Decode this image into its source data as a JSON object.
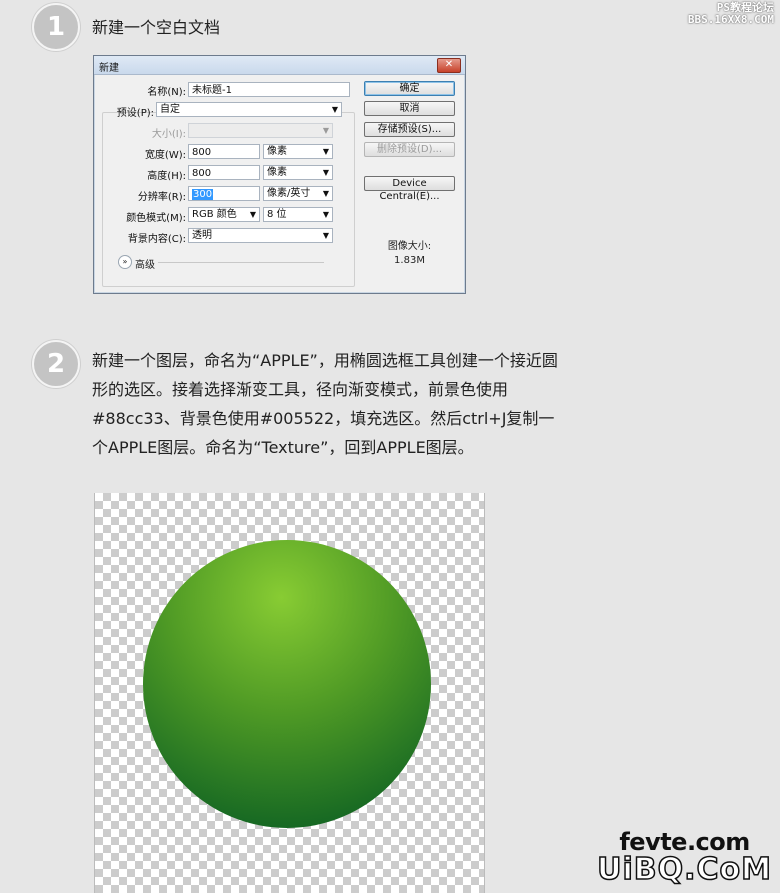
{
  "watermark_top": {
    "line1": "PS教程论坛",
    "line2": "BBS.16XX8.COM"
  },
  "steps": [
    {
      "number": "1",
      "title": "新建一个空白文档"
    },
    {
      "number": "2",
      "text": "新建一个图层，命名为“APPLE”，用椭圆选框工具创建一个接近圆形的选区。接着选择渐变工具，径向渐变模式，前景色使用#88cc33、背景色使用#005522，填充选区。然后ctrl+J复制一个APPLE图层。命名为“Texture”，回到APPLE图层。"
    }
  ],
  "dialog": {
    "title": "新建",
    "close": "✕",
    "name_label": "名称(N):",
    "name_value": "未标题-1",
    "preset_label": "预设(P):",
    "preset_value": "自定",
    "size_label": "大小(I):",
    "width_label": "宽度(W):",
    "width_value": "800",
    "width_unit": "像素",
    "height_label": "高度(H):",
    "height_value": "800",
    "height_unit": "像素",
    "resolution_label": "分辨率(R):",
    "resolution_value": "300",
    "resolution_unit": "像素/英寸",
    "color_mode_label": "颜色模式(M):",
    "color_mode_value": "RGB 颜色",
    "bit_depth": "8 位",
    "background_label": "背景内容(C):",
    "background_value": "透明",
    "advanced_label": "高级",
    "buttons": {
      "ok": "确定",
      "cancel": "取消",
      "save_preset": "存储预设(S)...",
      "delete_preset": "删除预设(D)...",
      "device_central": "Device Central(E)..."
    },
    "image_size_label": "图像大小:",
    "image_size_value": "1.83M"
  },
  "colors": {
    "foreground": "#88cc33",
    "background": "#005522"
  },
  "logo": {
    "line1": "fevte.com",
    "line2": "UiBQ.CoM"
  }
}
